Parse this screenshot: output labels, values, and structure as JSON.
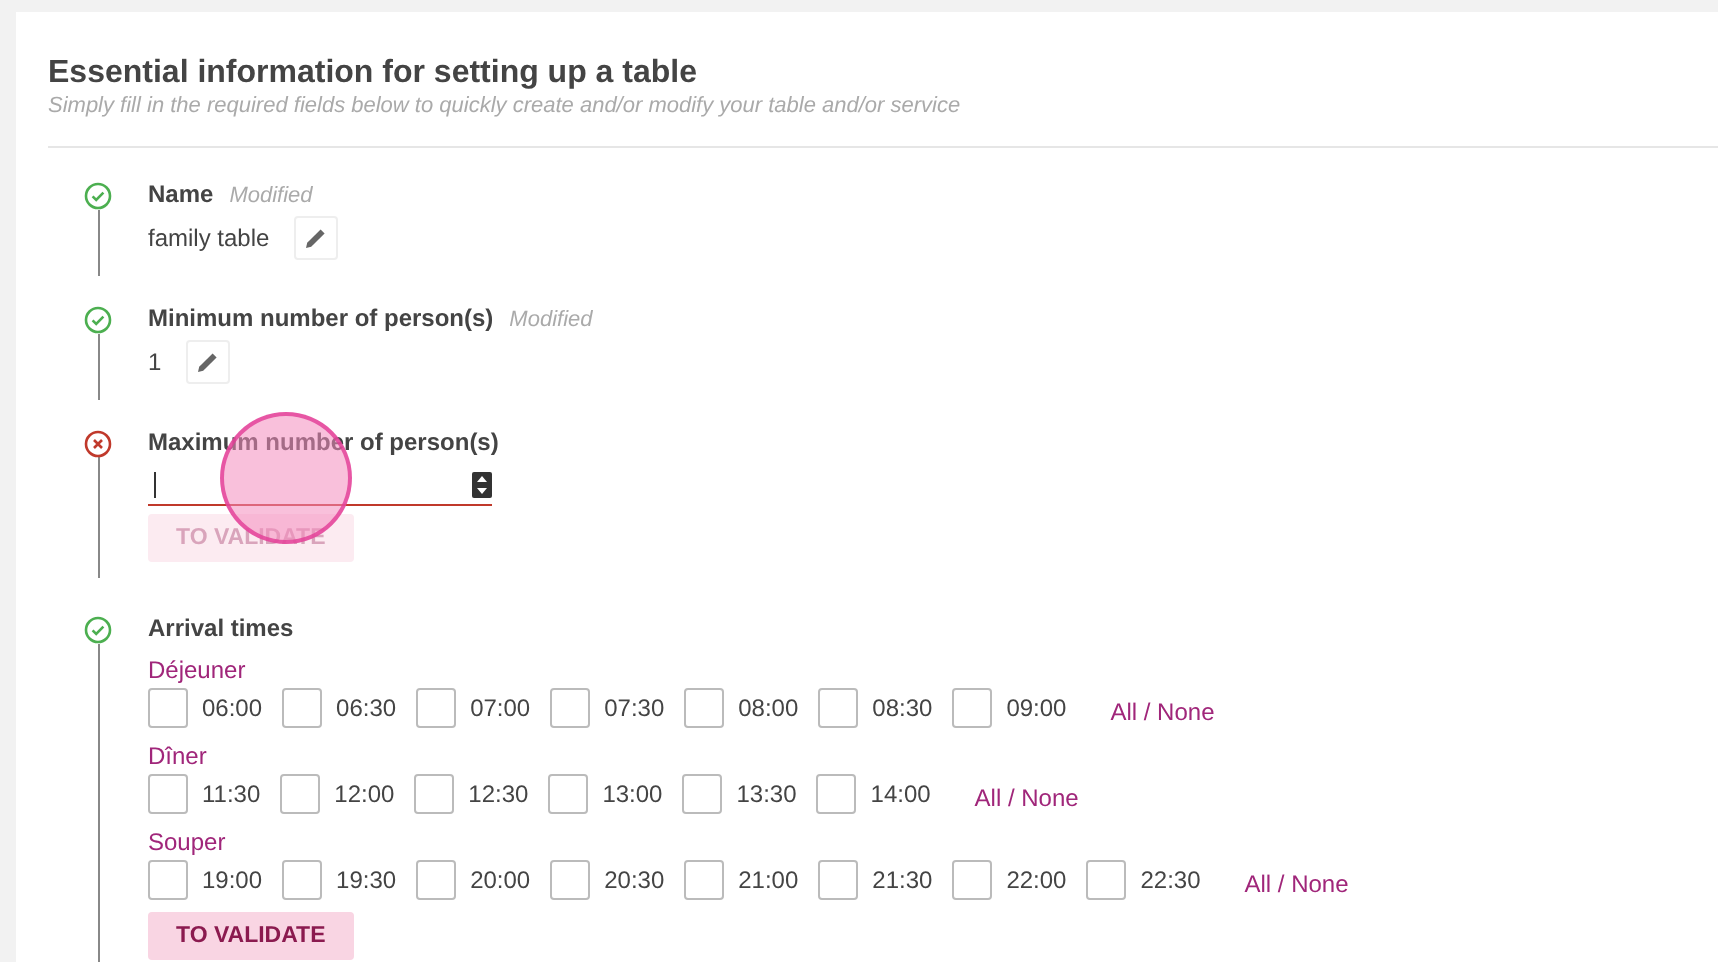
{
  "header": {
    "title": "Essential information for setting up a table",
    "subtitle": "Simply fill in the required fields below to quickly create and/or modify your table and/or service"
  },
  "steps": [
    {
      "kind": "value",
      "valid": true,
      "label": "Name",
      "note": "Modified",
      "value": "family table"
    },
    {
      "kind": "value",
      "valid": true,
      "label": "Minimum number of person(s)",
      "note": "Modified",
      "value": "1"
    },
    {
      "kind": "number",
      "valid": false,
      "label": "Maximum number of person(s)",
      "button": {
        "label": "TO VALIDATE",
        "disabled": true
      }
    },
    {
      "kind": "times",
      "valid": true,
      "label": "Arrival times",
      "groups": [
        {
          "name": "Déjeuner",
          "toggle": "All / None",
          "times": [
            {
              "label": "06:00",
              "checked": false
            },
            {
              "label": "06:30",
              "checked": false
            },
            {
              "label": "07:00",
              "checked": false
            },
            {
              "label": "07:30",
              "checked": false
            },
            {
              "label": "08:00",
              "checked": false
            },
            {
              "label": "08:30",
              "checked": false
            },
            {
              "label": "09:00",
              "checked": false
            }
          ]
        },
        {
          "name": "Dîner",
          "toggle": "All / None",
          "times": [
            {
              "label": "11:30",
              "checked": false
            },
            {
              "label": "12:00",
              "checked": false
            },
            {
              "label": "12:30",
              "checked": false
            },
            {
              "label": "13:00",
              "checked": false
            },
            {
              "label": "13:30",
              "checked": false
            },
            {
              "label": "14:00",
              "checked": false
            }
          ]
        },
        {
          "name": "Souper",
          "toggle": "All / None",
          "times": [
            {
              "label": "19:00",
              "checked": false
            },
            {
              "label": "19:30",
              "checked": false
            },
            {
              "label": "20:00",
              "checked": false
            },
            {
              "label": "20:30",
              "checked": false
            },
            {
              "label": "21:00",
              "checked": false
            },
            {
              "label": "21:30",
              "checked": false
            },
            {
              "label": "22:00",
              "checked": false
            },
            {
              "label": "22:30",
              "checked": false
            }
          ]
        }
      ],
      "button": {
        "label": "TO VALIDATE",
        "disabled": false
      }
    }
  ],
  "click_indicator": {
    "kind": "circle"
  }
}
